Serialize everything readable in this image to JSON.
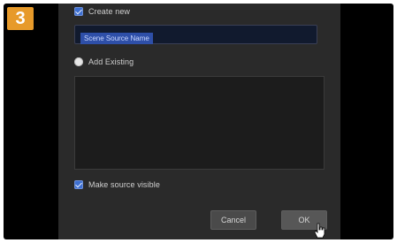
{
  "step": {
    "number": "3"
  },
  "dialog": {
    "create_new": {
      "label": "Create new",
      "checked": true
    },
    "name_input": {
      "value": "Scene Source Name"
    },
    "add_existing": {
      "label": "Add Existing",
      "selected": true
    },
    "make_visible": {
      "label": "Make source visible",
      "checked": true
    },
    "buttons": {
      "cancel": "Cancel",
      "ok": "OK"
    }
  },
  "colors": {
    "badge": "#e79a2a",
    "accent": "#3d6fd1",
    "dialog_bg": "#2a2a2a"
  },
  "icons": {
    "cursor": "hand-pointer-icon"
  }
}
